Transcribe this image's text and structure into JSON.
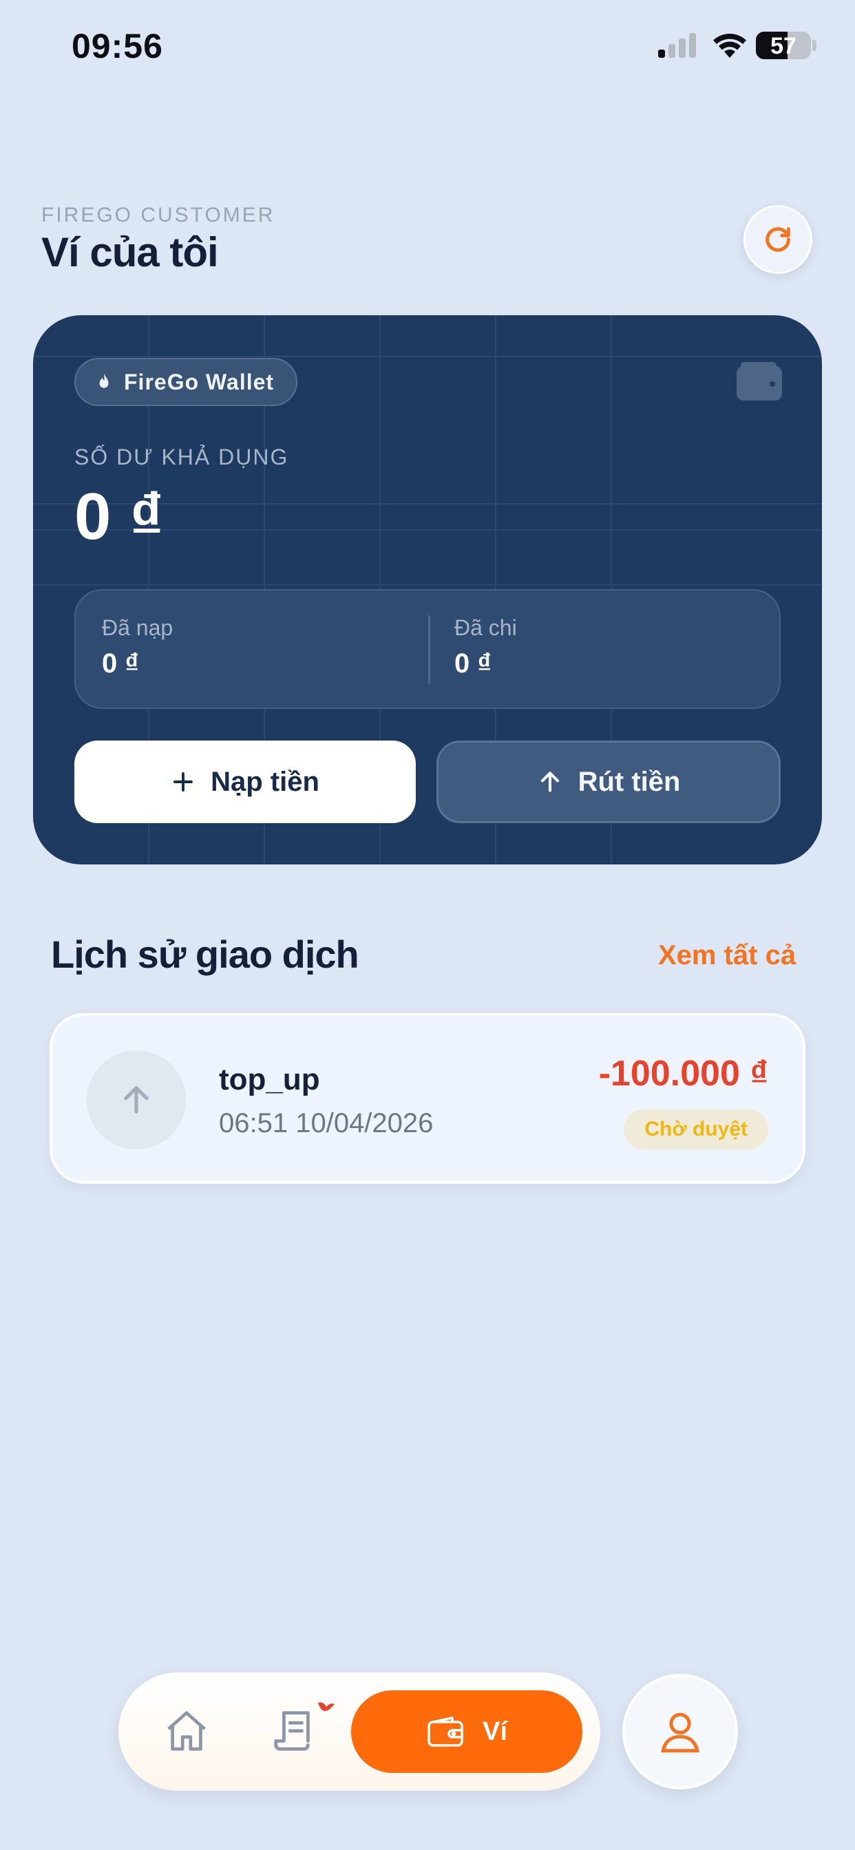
{
  "status_bar": {
    "time": "09:56",
    "battery": "57"
  },
  "header": {
    "kicker": "FIREGO CUSTOMER",
    "title": "Ví của tôi",
    "refresh_icon": "refresh-icon"
  },
  "wallet": {
    "badge_label": "FireGo Wallet",
    "badge_icon": "flame-icon",
    "balance_label": "SỐ DƯ KHẢ DỤNG",
    "balance_value": "0 ₫",
    "stats": [
      {
        "label": "Đã nạp",
        "value": "0 ₫"
      },
      {
        "label": "Đã chi",
        "value": "0 ₫"
      }
    ],
    "deposit_label": "Nạp tiền",
    "withdraw_label": "Rút tiền"
  },
  "history": {
    "title": "Lịch sử giao dịch",
    "see_all": "Xem tất cả",
    "transactions": [
      {
        "title": "top_up",
        "time": "06:51 10/04/2026",
        "amount": "-100.000 ₫",
        "status": "Chờ duyệt"
      }
    ]
  },
  "nav": {
    "active_label": "Ví"
  },
  "colors": {
    "accent": "#ff6b0a",
    "card": "#1f3a60",
    "negative": "#e8432a",
    "pending": "#efb70f",
    "background": "#dde6f4"
  }
}
